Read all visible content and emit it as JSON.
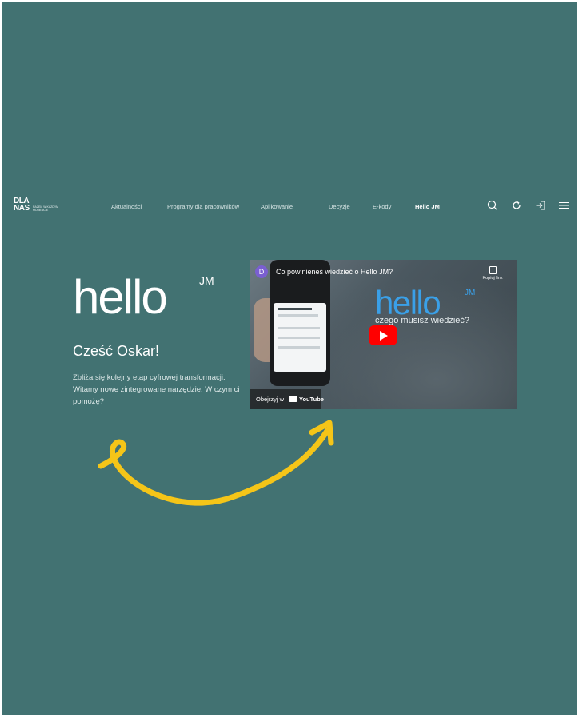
{
  "header": {
    "logo": {
      "line1": "DLA",
      "line2": "NAS",
      "tagline": "RAZEM W KAŻDYM MOMENCIE"
    },
    "nav": [
      "Aktualności",
      "Programy dla pracowników",
      "Aplikowanie",
      "Decyzje",
      "E-kody",
      "Hello JM"
    ],
    "active_nav": "Hello JM",
    "icons": [
      "search-icon",
      "refresh-icon",
      "login-icon",
      "menu-icon"
    ]
  },
  "hero": {
    "brand": "hello",
    "brand_sup": "JM",
    "greeting": "Cześć Oskar!",
    "description": "Zbliża się kolejny etap cyfrowej transformacji. Witamy nowe zintegrowane narzędzie. W czym ci pomożę?"
  },
  "video": {
    "channel_initial": "D",
    "title": "Co powinieneś wiedzieć o Hello JM?",
    "copy_link": "Kopiuj link",
    "brand": "hello",
    "brand_sup": "JM",
    "subtitle": "czego musisz wiedzieć?",
    "watch_label": "Obejrzyj w",
    "youtube": "YouTube"
  },
  "colors": {
    "background": "#427272",
    "accent_arrow": "#f5c518",
    "play_red": "#ff0000",
    "hello_blue": "#3aa0e8"
  }
}
